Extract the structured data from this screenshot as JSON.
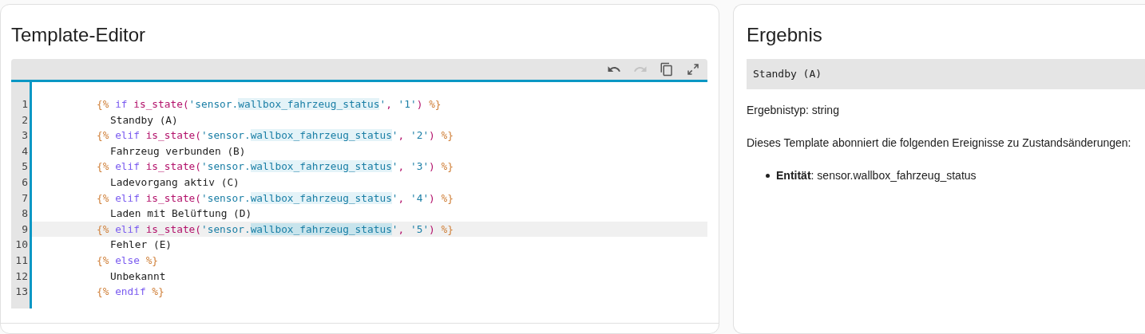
{
  "editor_card": {
    "title": "Template-Editor",
    "toolbar": [
      {
        "kind": "undo",
        "disabled": false
      },
      {
        "kind": "redo",
        "disabled": true
      },
      {
        "kind": "copy",
        "disabled": false
      },
      {
        "kind": "fullscreen",
        "disabled": false
      }
    ],
    "lines": [
      {
        "number": "1",
        "kind": "tag",
        "active": false,
        "tokens": [
          {
            "text": "{%",
            "kind": "delim"
          },
          {
            "text": " if ",
            "kind": "keyword"
          },
          {
            "text": "is_state(",
            "kind": "func"
          },
          {
            "text": "'sensor.",
            "kind": "string"
          },
          {
            "text": "wallbox_fahrzeug_status",
            "kind": "match"
          },
          {
            "text": "'",
            "kind": "string"
          },
          {
            "text": ", ",
            "kind": "punct"
          },
          {
            "text": "'1'",
            "kind": "string"
          },
          {
            "text": ")",
            "kind": "func"
          },
          {
            "text": " %}",
            "kind": "delim"
          }
        ]
      },
      {
        "number": "2",
        "kind": "output",
        "active": false,
        "tokens": [
          {
            "text": "Standby (A)",
            "kind": "text"
          }
        ]
      },
      {
        "number": "3",
        "kind": "tag",
        "active": false,
        "tokens": [
          {
            "text": "{%",
            "kind": "delim"
          },
          {
            "text": " elif ",
            "kind": "keyword"
          },
          {
            "text": "is_state(",
            "kind": "func"
          },
          {
            "text": "'sensor.",
            "kind": "string"
          },
          {
            "text": "wallbox_fahrzeug_status",
            "kind": "match"
          },
          {
            "text": "'",
            "kind": "string"
          },
          {
            "text": ", ",
            "kind": "punct"
          },
          {
            "text": "'2'",
            "kind": "string"
          },
          {
            "text": ")",
            "kind": "func"
          },
          {
            "text": " %}",
            "kind": "delim"
          }
        ]
      },
      {
        "number": "4",
        "kind": "output",
        "active": false,
        "tokens": [
          {
            "text": "Fahrzeug verbunden (B)",
            "kind": "text"
          }
        ]
      },
      {
        "number": "5",
        "kind": "tag",
        "active": false,
        "tokens": [
          {
            "text": "{%",
            "kind": "delim"
          },
          {
            "text": " elif ",
            "kind": "keyword"
          },
          {
            "text": "is_state(",
            "kind": "func"
          },
          {
            "text": "'sensor.",
            "kind": "string"
          },
          {
            "text": "wallbox_fahrzeug_status",
            "kind": "match"
          },
          {
            "text": "'",
            "kind": "string"
          },
          {
            "text": ", ",
            "kind": "punct"
          },
          {
            "text": "'3'",
            "kind": "string"
          },
          {
            "text": ")",
            "kind": "func"
          },
          {
            "text": " %}",
            "kind": "delim"
          }
        ]
      },
      {
        "number": "6",
        "kind": "output",
        "active": false,
        "tokens": [
          {
            "text": "Ladevorgang aktiv (C)",
            "kind": "text"
          }
        ]
      },
      {
        "number": "7",
        "kind": "tag",
        "active": false,
        "tokens": [
          {
            "text": "{%",
            "kind": "delim"
          },
          {
            "text": " elif ",
            "kind": "keyword"
          },
          {
            "text": "is_state(",
            "kind": "func"
          },
          {
            "text": "'sensor.",
            "kind": "string"
          },
          {
            "text": "wallbox_fahrzeug_status",
            "kind": "match"
          },
          {
            "text": "'",
            "kind": "string"
          },
          {
            "text": ", ",
            "kind": "punct"
          },
          {
            "text": "'4'",
            "kind": "string"
          },
          {
            "text": ")",
            "kind": "func"
          },
          {
            "text": " %}",
            "kind": "delim"
          }
        ]
      },
      {
        "number": "8",
        "kind": "output",
        "active": false,
        "tokens": [
          {
            "text": "Laden mit Belüftung (D)",
            "kind": "text"
          }
        ]
      },
      {
        "number": "9",
        "kind": "tag",
        "active": true,
        "tokens": [
          {
            "text": "{%",
            "kind": "delim"
          },
          {
            "text": " elif ",
            "kind": "keyword"
          },
          {
            "text": "is_state(",
            "kind": "func"
          },
          {
            "text": "'sensor.",
            "kind": "string"
          },
          {
            "text": "wallbox_fahrzeug_status",
            "kind": "match"
          },
          {
            "text": "'",
            "kind": "string"
          },
          {
            "text": ", ",
            "kind": "punct"
          },
          {
            "text": "'5'",
            "kind": "string"
          },
          {
            "text": ")",
            "kind": "func"
          },
          {
            "text": " %}",
            "kind": "delim"
          }
        ]
      },
      {
        "number": "10",
        "kind": "output",
        "active": false,
        "tokens": [
          {
            "text": "Fehler (E)",
            "kind": "text"
          }
        ]
      },
      {
        "number": "11",
        "kind": "tag",
        "active": false,
        "tokens": [
          {
            "text": "{%",
            "kind": "delim"
          },
          {
            "text": " else ",
            "kind": "keyword"
          },
          {
            "text": "%}",
            "kind": "delim"
          }
        ]
      },
      {
        "number": "12",
        "kind": "output",
        "active": false,
        "tokens": [
          {
            "text": "Unbekannt",
            "kind": "text"
          }
        ]
      },
      {
        "number": "13",
        "kind": "tag",
        "active": false,
        "tokens": [
          {
            "text": "{%",
            "kind": "delim"
          },
          {
            "text": " endif ",
            "kind": "keyword"
          },
          {
            "text": "%}",
            "kind": "delim"
          }
        ]
      }
    ]
  },
  "result_card": {
    "title": "Ergebnis",
    "output": "Standby (A)",
    "result_type": "Ergebnistyp: string",
    "description": "Dieses Template abonniert die folgenden Ereignisse zu Zustandsänderungen:",
    "listeners": [
      {
        "label": "Entität",
        "value": ": sensor.wallbox_fahrzeug_status"
      }
    ]
  }
}
